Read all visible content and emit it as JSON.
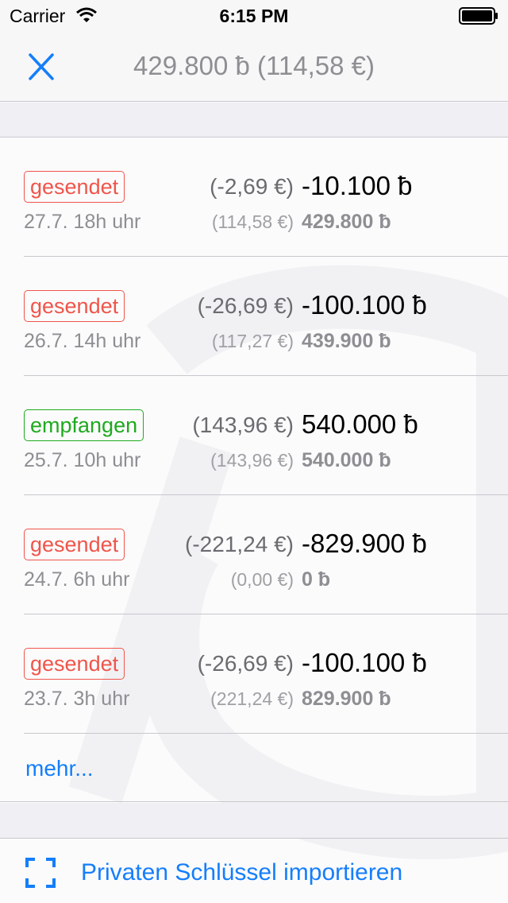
{
  "status_bar": {
    "carrier": "Carrier",
    "time": "6:15 PM",
    "icons": [
      "wifi-icon",
      "battery-icon"
    ]
  },
  "nav": {
    "close_icon": "close-icon",
    "title": "429.800 ƀ (114,58 €)"
  },
  "transactions": [
    {
      "type": "sent",
      "label": "gesendet",
      "date": "27.7. 18h uhr",
      "amount_eur": "(-2,69 €)",
      "amount_btc": "-10.100 ƀ",
      "balance_eur": "(114,58 €)",
      "balance_btc": "429.800 ƀ"
    },
    {
      "type": "sent",
      "label": "gesendet",
      "date": "26.7. 14h uhr",
      "amount_eur": "(-26,69 €)",
      "amount_btc": "-100.100 ƀ",
      "balance_eur": "(117,27 €)",
      "balance_btc": "439.900 ƀ"
    },
    {
      "type": "received",
      "label": "empfangen",
      "date": "25.7. 10h uhr",
      "amount_eur": "(143,96 €)",
      "amount_btc": "540.000 ƀ",
      "balance_eur": "(143,96 €)",
      "balance_btc": "540.000 ƀ"
    },
    {
      "type": "sent",
      "label": "gesendet",
      "date": "24.7. 6h uhr",
      "amount_eur": "(-221,24 €)",
      "amount_btc": "-829.900 ƀ",
      "balance_eur": "(0,00 €)",
      "balance_btc": "0 ƀ"
    },
    {
      "type": "sent",
      "label": "gesendet",
      "date": "23.7. 3h uhr",
      "amount_eur": "(-26,69 €)",
      "amount_btc": "-100.100 ƀ",
      "balance_eur": "(221,24 €)",
      "balance_btc": "829.900 ƀ"
    }
  ],
  "more_label": "mehr...",
  "import": {
    "icon": "scan-icon",
    "label": "Privaten Schlüssel importieren"
  },
  "colors": {
    "accent": "#157efb",
    "sent": "#f0554a",
    "received": "#1faa1f"
  }
}
